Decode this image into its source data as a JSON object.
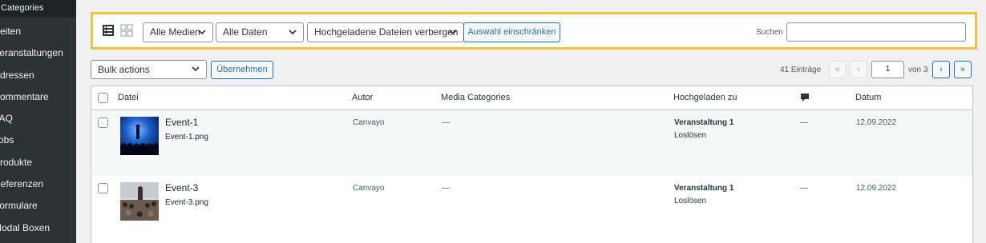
{
  "sidebar": {
    "top_label": "a Categories",
    "items": [
      {
        "label": "Seiten"
      },
      {
        "label": "Veranstaltungen"
      },
      {
        "label": "Adressen"
      },
      {
        "label": "Kommentare"
      },
      {
        "label": "FAQ"
      },
      {
        "label": "Jobs"
      },
      {
        "label": "Produkte"
      },
      {
        "label": "Referenzen"
      },
      {
        "label": "Formulare"
      },
      {
        "label": "Modal Boxen"
      }
    ]
  },
  "filters": {
    "media_type": "Alle Medien",
    "dates": "Alle Daten",
    "uploaded": "Hochgeladene Dateien verbergen",
    "restrict_button": "Auswahl einschränken",
    "search_label": "Suchen",
    "search_value": ""
  },
  "bulk": {
    "select_value": "Bulk actions",
    "apply_button": "Übernehmen"
  },
  "pagination": {
    "count": "41 Einträge",
    "first": "«",
    "prev": "‹",
    "current_page": "1",
    "of_label": "von 3",
    "next": "›",
    "last": "»"
  },
  "table": {
    "columns": {
      "file": "Datei",
      "author": "Autor",
      "categories": "Media Categories",
      "uploaded_to": "Hochgeladen zu",
      "comments_icon": "comment-bubble-icon",
      "date": "Datum"
    },
    "rows": [
      {
        "title": "Event-1",
        "filename": "Event-1.png",
        "author": "Canvayo",
        "categories": "—",
        "uploaded_to": "Veranstaltung 1",
        "detach": "Loslösen",
        "comments": "—",
        "date": "12.09.2022"
      },
      {
        "title": "Event-3",
        "filename": "Event-3.png",
        "author": "Canvayo",
        "categories": "—",
        "uploaded_to": "Veranstaltung 1",
        "detach": "Loslösen",
        "comments": "—",
        "date": "12.09.2022"
      }
    ]
  },
  "colors": {
    "highlight_border": "#f0c33c",
    "link_blue": "#2271b1",
    "sidebar_bg": "#2c3338"
  }
}
